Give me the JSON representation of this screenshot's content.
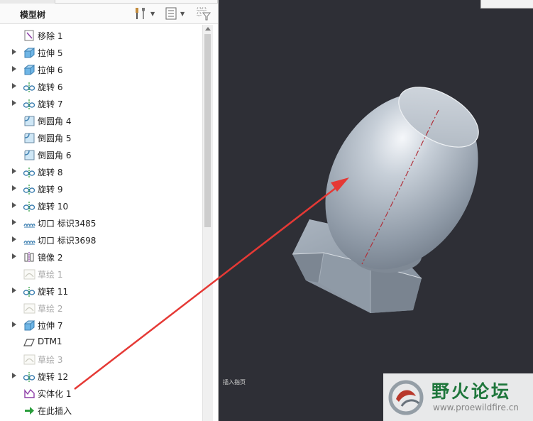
{
  "panel": {
    "title": "模型树",
    "header_icons": [
      "settings-tools-icon",
      "tree-columns-icon",
      "filter-icon"
    ],
    "items": [
      {
        "label": "移除 1",
        "icon": "remove-feature-icon",
        "expandable": false,
        "suppressed": false
      },
      {
        "label": "拉伸 5",
        "icon": "extrude-icon",
        "expandable": true,
        "suppressed": false
      },
      {
        "label": "拉伸 6",
        "icon": "extrude-icon",
        "expandable": true,
        "suppressed": false
      },
      {
        "label": "旋转 6",
        "icon": "revolve-icon",
        "expandable": true,
        "suppressed": false
      },
      {
        "label": "旋转 7",
        "icon": "revolve-icon",
        "expandable": true,
        "suppressed": false
      },
      {
        "label": "倒圆角 4",
        "icon": "round-icon",
        "expandable": false,
        "suppressed": false
      },
      {
        "label": "倒圆角 5",
        "icon": "round-icon",
        "expandable": false,
        "suppressed": false
      },
      {
        "label": "倒圆角 6",
        "icon": "round-icon",
        "expandable": false,
        "suppressed": false
      },
      {
        "label": "旋转 8",
        "icon": "revolve-icon",
        "expandable": true,
        "suppressed": false
      },
      {
        "label": "旋转 9",
        "icon": "revolve-icon",
        "expandable": true,
        "suppressed": false
      },
      {
        "label": "旋转 10",
        "icon": "revolve-icon",
        "expandable": true,
        "suppressed": false
      },
      {
        "label": "切口 标识3485",
        "icon": "cosmetic-thread-icon",
        "expandable": true,
        "suppressed": false
      },
      {
        "label": "切口 标识3698",
        "icon": "cosmetic-thread-icon",
        "expandable": true,
        "suppressed": false
      },
      {
        "label": "镜像 2",
        "icon": "mirror-icon",
        "expandable": true,
        "suppressed": false
      },
      {
        "label": "草绘 1",
        "icon": "sketch-icon",
        "expandable": false,
        "suppressed": true
      },
      {
        "label": "旋转 11",
        "icon": "revolve-icon",
        "expandable": true,
        "suppressed": false
      },
      {
        "label": "草绘 2",
        "icon": "sketch-icon",
        "expandable": false,
        "suppressed": true
      },
      {
        "label": "拉伸 7",
        "icon": "extrude-icon",
        "expandable": true,
        "suppressed": false
      },
      {
        "label": "DTM1",
        "icon": "datum-plane-icon",
        "expandable": false,
        "suppressed": false
      },
      {
        "label": "草绘 3",
        "icon": "sketch-icon",
        "expandable": false,
        "suppressed": true
      },
      {
        "label": "旋转 12",
        "icon": "revolve-icon",
        "expandable": true,
        "suppressed": false
      },
      {
        "label": "实体化 1",
        "icon": "solidify-icon",
        "expandable": false,
        "suppressed": false
      },
      {
        "label": "在此插入",
        "icon": "insert-here-arrow-icon",
        "expandable": false,
        "suppressed": false
      }
    ]
  },
  "viewport": {
    "insert_hint": "插入指页",
    "background_color": "#2e2f36",
    "annotation_arrow_color": "#e53935",
    "model_color": "#a9b4c1"
  },
  "watermark": {
    "title": "野火论坛",
    "url": "www.proewildfire.cn"
  }
}
